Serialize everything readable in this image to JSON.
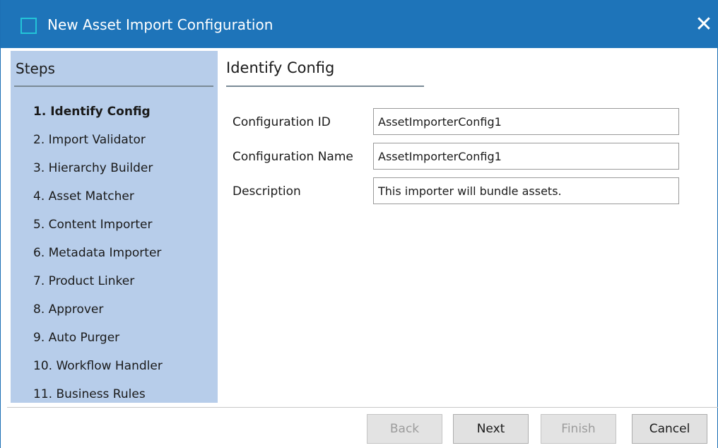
{
  "window": {
    "title": "New Asset Import Configuration",
    "close_label": "✕"
  },
  "steps": {
    "header": "Steps",
    "items": [
      {
        "label": "1. Identify Config",
        "active": true
      },
      {
        "label": "2. Import Validator"
      },
      {
        "label": "3. Hierarchy Builder"
      },
      {
        "label": "4. Asset Matcher"
      },
      {
        "label": "5. Content Importer"
      },
      {
        "label": "6. Metadata Importer"
      },
      {
        "label": "7. Product Linker"
      },
      {
        "label": "8. Approver"
      },
      {
        "label": "9. Auto Purger"
      },
      {
        "label": "10. Workflow Handler"
      },
      {
        "label": "11. Business Rules"
      }
    ]
  },
  "content": {
    "header": "Identify Config"
  },
  "form": {
    "configuration_id": {
      "label": "Configuration ID",
      "value": "AssetImporterConfig1"
    },
    "configuration_name": {
      "label": "Configuration Name",
      "value": "AssetImporterConfig1"
    },
    "description": {
      "label": "Description",
      "value": "This importer will bundle assets."
    }
  },
  "footer": {
    "back": "Back",
    "next": "Next",
    "finish": "Finish",
    "cancel": "Cancel"
  },
  "colors": {
    "titlebar": "#1e74b9",
    "steps_panel": "#b7cdea",
    "icon_accent": "#23c4d8"
  }
}
